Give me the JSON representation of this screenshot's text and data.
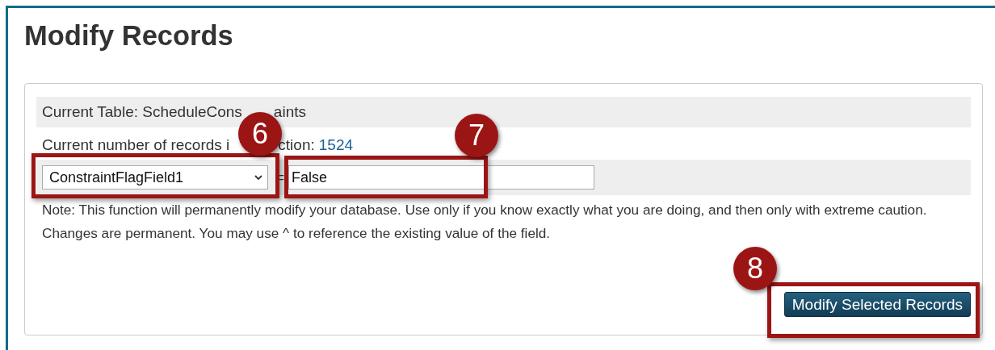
{
  "title": "Modify Records",
  "panel": {
    "table_line": [
      "Current Table: ScheduleCons",
      "aints"
    ],
    "count_line": [
      "Current number of records i",
      "ction:",
      "1524"
    ],
    "field_select": {
      "value": "ConstraintFlagField1"
    },
    "equals": "=",
    "value_field": {
      "value": "False"
    },
    "note": "Note: This function will permanently modify your database. Use only if you know exactly what you are doing, and then only with extreme caution. Changes are permanent. You may use ^ to reference the existing value of the field.",
    "button": "Modify Selected Records"
  },
  "callouts": [
    {
      "number": "6"
    },
    {
      "number": "7"
    },
    {
      "number": "8"
    }
  ]
}
